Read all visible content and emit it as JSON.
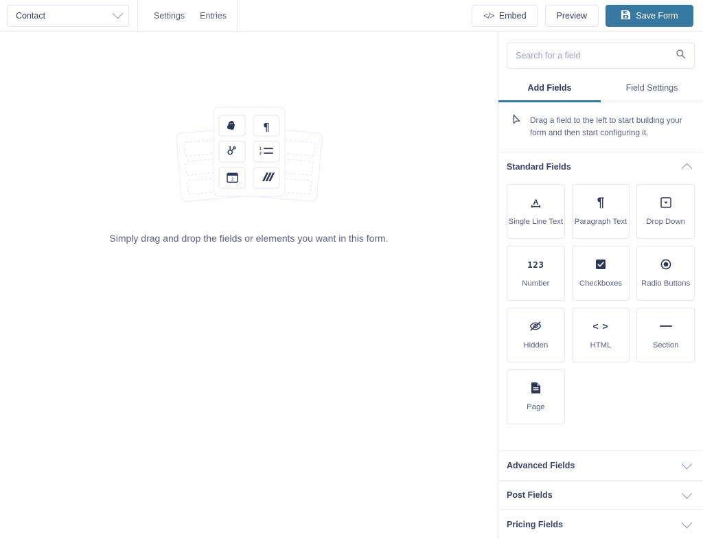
{
  "topbar": {
    "form_selector": {
      "value": "Contact",
      "icon": "chevron-down-icon"
    },
    "nav": [
      {
        "label": "Settings"
      },
      {
        "label": "Entries"
      }
    ],
    "embed_button": {
      "label": "Embed",
      "icon": "code-icon"
    },
    "preview_button": {
      "label": "Preview"
    },
    "save_button": {
      "label": "Save Form",
      "icon": "save-disk-icon",
      "color": "#3778a0"
    }
  },
  "canvas": {
    "empty_message": "Simply drag and drop the fields or elements you want in this form.",
    "illustration": {
      "name": "form-cards-illustration",
      "tiles": [
        "mailchimp-icon",
        "paragraph-icon",
        "hubspot-icon",
        "numbered-list-icon",
        "calendar-icon",
        "stripe-icon"
      ]
    }
  },
  "sidebar": {
    "search": {
      "placeholder": "Search for a field",
      "value": "",
      "icon": "search-icon"
    },
    "tabs": [
      {
        "label": "Add Fields",
        "active": true
      },
      {
        "label": "Field Settings",
        "active": false
      }
    ],
    "active_tab_color": "#3778a0",
    "hint": {
      "icon": "cursor-pointer-icon",
      "text": "Drag a field to the left to start building your form and then start configuring it."
    },
    "sections": [
      {
        "title": "Standard Fields",
        "expanded": true,
        "chevron": "chevron-up-icon",
        "fields": [
          {
            "label": "Single Line Text",
            "icon": "text-underline-a-icon"
          },
          {
            "label": "Paragraph Text",
            "icon": "pilcrow-icon"
          },
          {
            "label": "Drop Down",
            "icon": "dropdown-square-icon"
          },
          {
            "label": "Number",
            "icon": "number-123-icon"
          },
          {
            "label": "Checkboxes",
            "icon": "checkbox-checked-icon"
          },
          {
            "label": "Radio Buttons",
            "icon": "radio-selected-icon"
          },
          {
            "label": "Hidden",
            "icon": "eye-slash-icon"
          },
          {
            "label": "HTML",
            "icon": "angle-brackets-icon"
          },
          {
            "label": "Section",
            "icon": "horizontal-line-icon"
          },
          {
            "label": "Page",
            "icon": "page-document-icon"
          }
        ]
      },
      {
        "title": "Advanced Fields",
        "expanded": false,
        "chevron": "chevron-down-icon",
        "fields": []
      },
      {
        "title": "Post Fields",
        "expanded": false,
        "chevron": "chevron-down-icon",
        "fields": []
      },
      {
        "title": "Pricing Fields",
        "expanded": false,
        "chevron": "chevron-down-icon",
        "fields": []
      }
    ]
  }
}
